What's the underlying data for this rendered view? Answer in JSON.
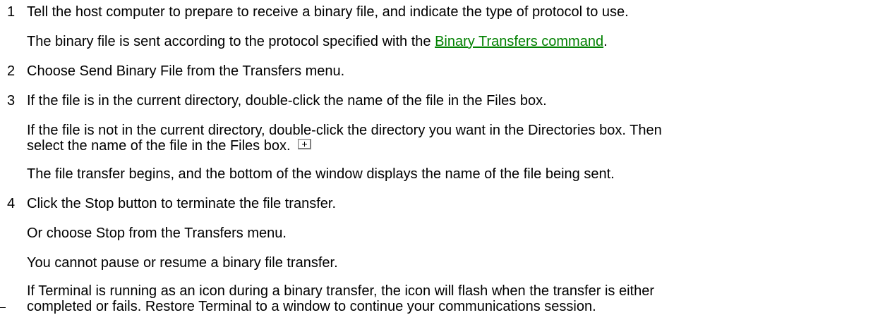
{
  "steps": [
    {
      "number": "1",
      "text": "Tell the host computer to prepare to receive a binary file, and indicate the type of protocol to use.",
      "notes": {
        "sent_prefix": "The binary file is sent according to the protocol specified with the ",
        "link_label": "Binary Transfers command",
        "sent_suffix": "."
      }
    },
    {
      "number": "2",
      "text": "Choose Send Binary File from the Transfers menu."
    },
    {
      "number": "3",
      "text": "If the file is in the current directory, double-click the name of the file in the Files box.",
      "alt_line1": "If the file is not in the current directory, double-click the directory you want in the Directories box. Then",
      "alt_line2": "select the name of the file in the Files box.",
      "expand_icon": "plus-box-icon",
      "result": "The file transfer begins, and the bottom of the window displays the name of the file being sent."
    },
    {
      "number": "4",
      "text": "Click the Stop button to terminate the file transfer.",
      "or_text": "Or choose Stop from the Transfers menu.",
      "note": "You cannot pause or resume a binary file transfer.",
      "icon_line1": "If Terminal is running as an icon during a binary transfer, the icon will flash when the transfer is either",
      "icon_line2": "completed or fails. Restore Terminal to a window to continue your communications session."
    }
  ],
  "colors": {
    "link": "#008000",
    "text": "#000000",
    "background": "#ffffff"
  }
}
